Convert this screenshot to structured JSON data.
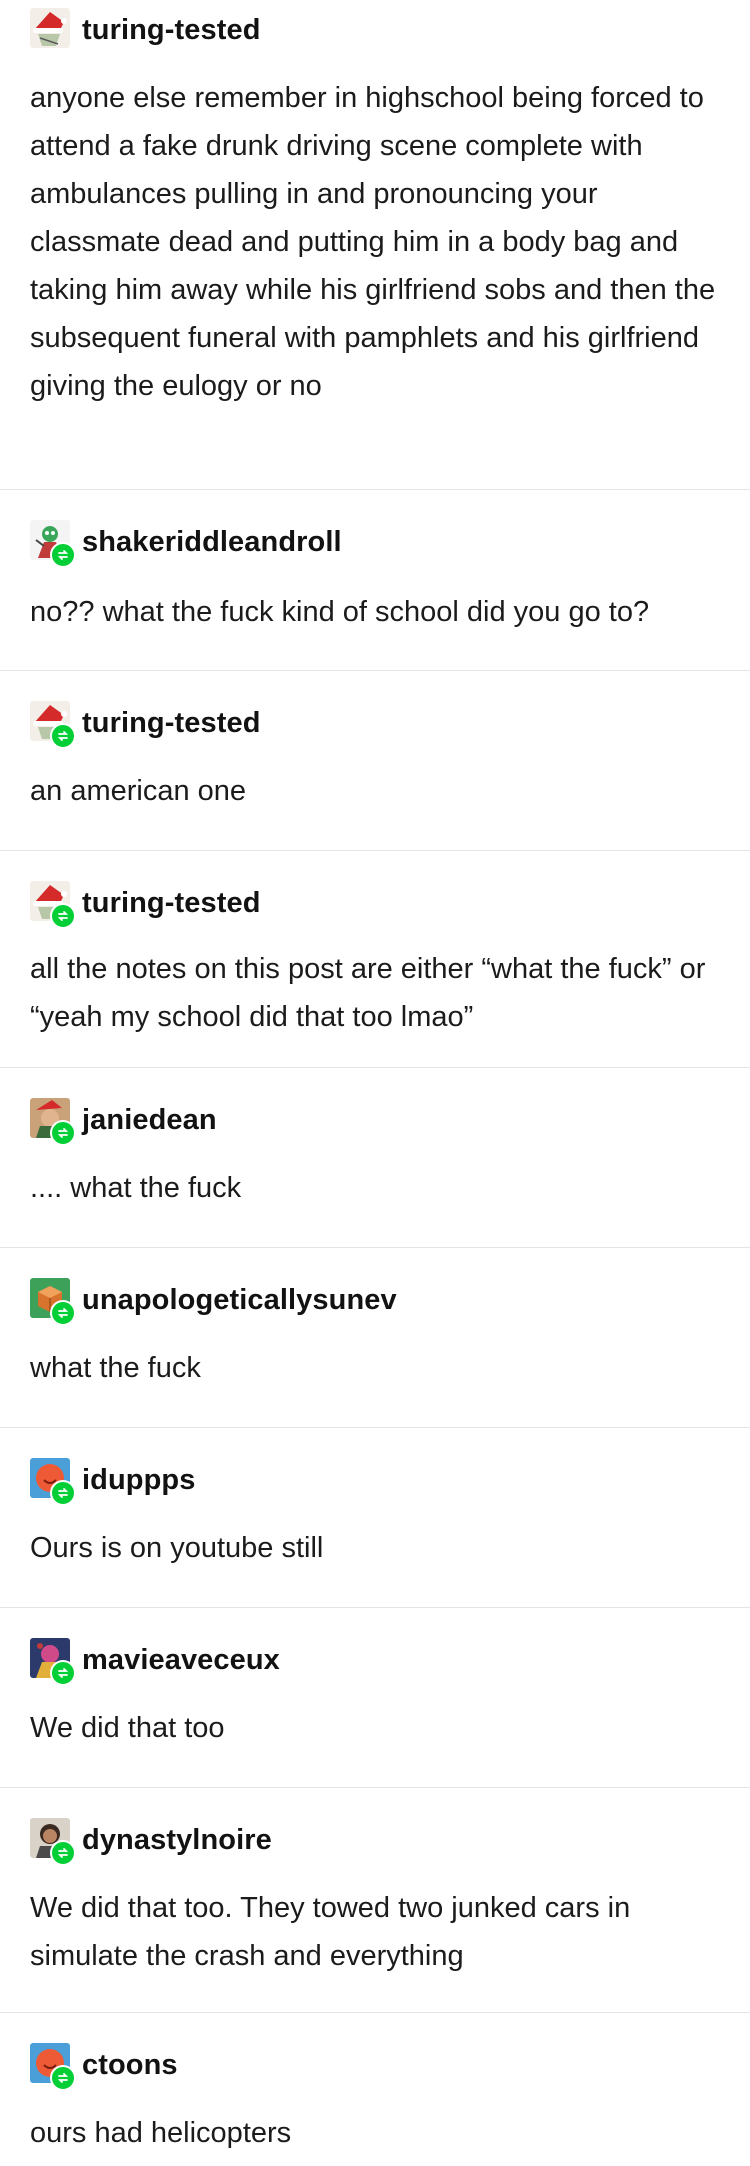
{
  "posts": [
    {
      "username": "turing-tested",
      "text": "anyone else remember in highschool being forced to attend a fake drunk driving scene complete with ambulances pulling in and pronouncing your classmate dead and putting him in a body bag and taking him away while his girlfriend sobs and then the subsequent funeral with pamphlets and his girlfriend giving the eulogy or no",
      "avatar": "santa-hat-avatar-icon",
      "reblog": false
    },
    {
      "username": "shakeriddleandroll",
      "text": "no?? what the fuck kind of school did you go to?",
      "avatar": "cartoon-avatar-icon",
      "reblog": true
    },
    {
      "username": "turing-tested",
      "text": "an american one",
      "avatar": "santa-hat-avatar-icon",
      "reblog": true
    },
    {
      "username": "turing-tested",
      "text": "all the notes on this post are either “what the fuck” or “yeah my school did that too lmao”",
      "avatar": "santa-hat-avatar-icon",
      "reblog": true
    },
    {
      "username": "janiedean",
      "text": ".... what the fuck",
      "avatar": "photo-avatar-icon",
      "reblog": true
    },
    {
      "username": "unapologeticallysunev",
      "text": "what the fuck",
      "avatar": "cube-avatar-icon",
      "reblog": true
    },
    {
      "username": "iduppps",
      "text": "Ours is on youtube still",
      "avatar": "orange-circle-avatar-icon",
      "reblog": true
    },
    {
      "username": "mavieaveceux",
      "text": "We did that too",
      "avatar": "illustration-avatar-icon",
      "reblog": true
    },
    {
      "username": "dynastylnoire",
      "text": "We did that too. They towed two junked cars in simulate the crash and everything",
      "avatar": "portrait-avatar-icon",
      "reblog": true
    },
    {
      "username": "ctoons",
      "text": "ours had helicopters",
      "avatar": "orange-circle-avatar-icon",
      "reblog": true
    }
  ],
  "colors": {
    "reblog_badge": "#01cf35",
    "divider": "#e4e4e4",
    "text": "#1b1b1b"
  }
}
